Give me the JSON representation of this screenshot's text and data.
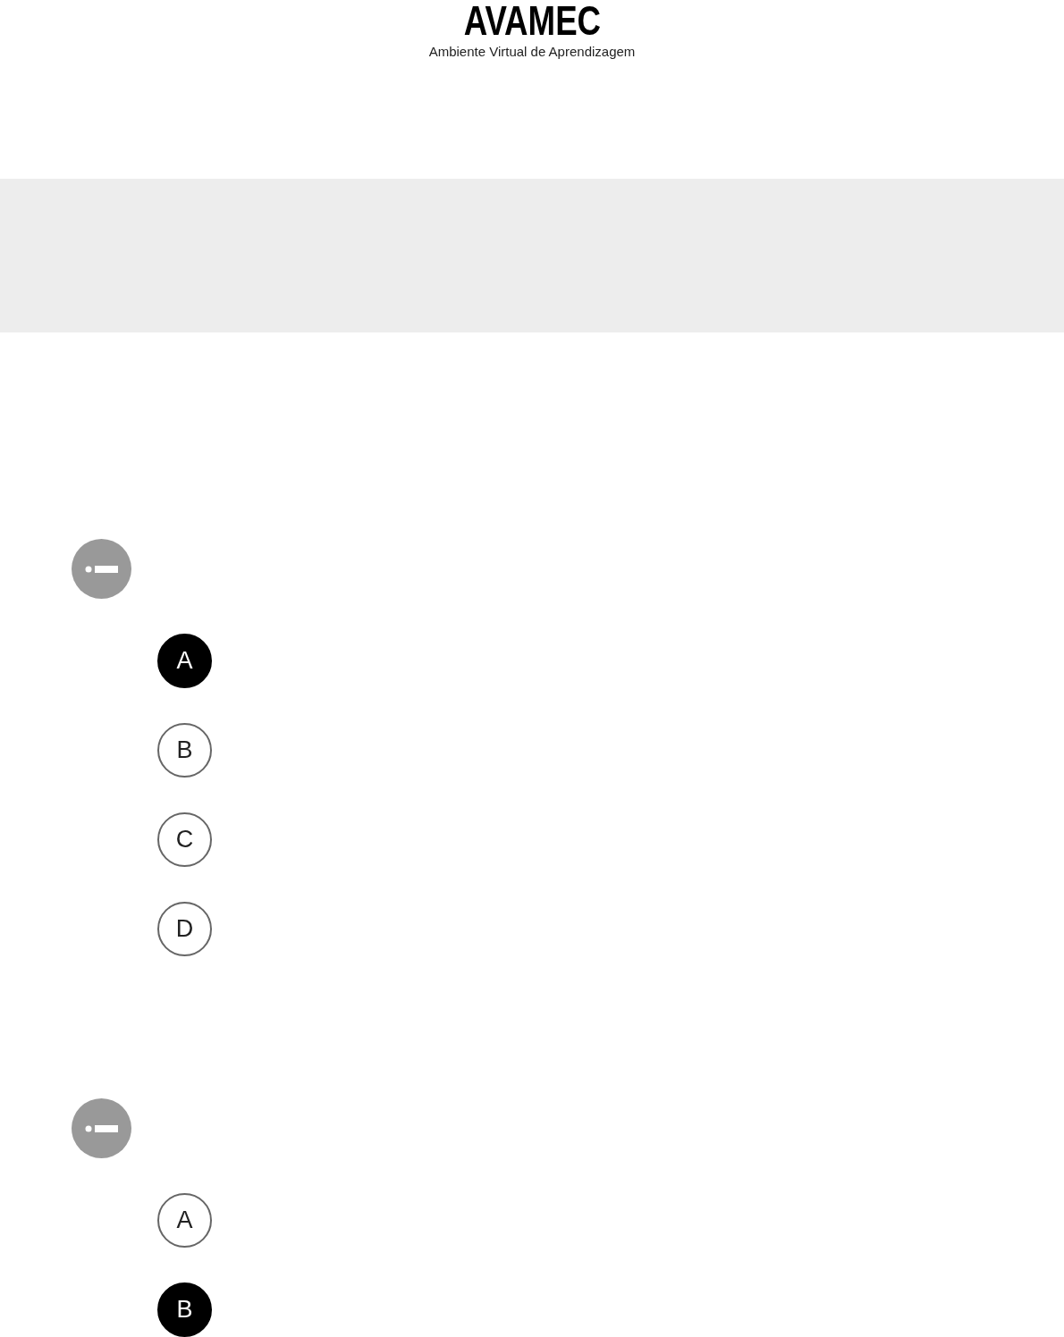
{
  "header": {
    "logo": "AVAMEC",
    "subtitle": "Ambiente Virtual de Aprendizagem"
  },
  "questions": [
    {
      "options": [
        {
          "letter": "A",
          "selected": true
        },
        {
          "letter": "B",
          "selected": false
        },
        {
          "letter": "C",
          "selected": false
        },
        {
          "letter": "D",
          "selected": false
        }
      ]
    },
    {
      "options": [
        {
          "letter": "A",
          "selected": false
        },
        {
          "letter": "B",
          "selected": true
        }
      ]
    }
  ]
}
